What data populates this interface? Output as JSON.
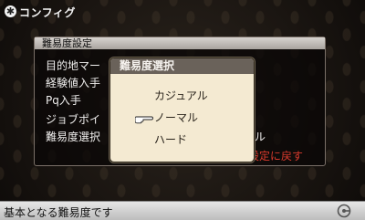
{
  "header": {
    "title": "コンフィグ",
    "icon": "gear-icon"
  },
  "panel": {
    "title": "難易度設定",
    "rows": [
      {
        "label": "目的地マー"
      },
      {
        "label": "経験値入手"
      },
      {
        "label": "Pq入手"
      },
      {
        "label": "ジョブポイ"
      },
      {
        "label": "難易度選択",
        "value": "ル"
      }
    ],
    "reset_label": "設定に戻す"
  },
  "dialog": {
    "title": "難易度選択",
    "options": [
      "カジュアル",
      "ノーマル",
      "ハード"
    ],
    "selected_index": 1
  },
  "footer": {
    "hint": "基本となる難易度です",
    "logo": "gamer-logo"
  },
  "colors": {
    "accent_red": "#d83a2d",
    "dialog_bg": "#f4ead2",
    "dialog_title_bg": "#6a625a"
  }
}
